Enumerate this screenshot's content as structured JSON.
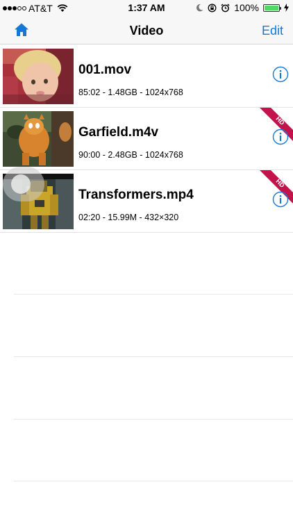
{
  "status_bar": {
    "carrier": "AT&T",
    "time": "1:37 AM",
    "battery": "100%",
    "battery_level": 1.0
  },
  "nav": {
    "title": "Video",
    "edit_label": "Edit",
    "home_icon": "house-icon"
  },
  "colors": {
    "accent": "#1478d4",
    "hd_ribbon": "#c4124a",
    "battery": "#4cd964"
  },
  "videos": [
    {
      "name": "001.mov",
      "meta": "85:02 - 1.48GB - 1024x768",
      "hd": false
    },
    {
      "name": "Garfield.m4v",
      "meta": "90:00 - 2.48GB - 1024x768",
      "hd": true,
      "badge": "HD"
    },
    {
      "name": "Transformers.mp4",
      "meta": "02:20  - 15.99M - 432×320",
      "hd": true,
      "badge": "HD"
    }
  ]
}
